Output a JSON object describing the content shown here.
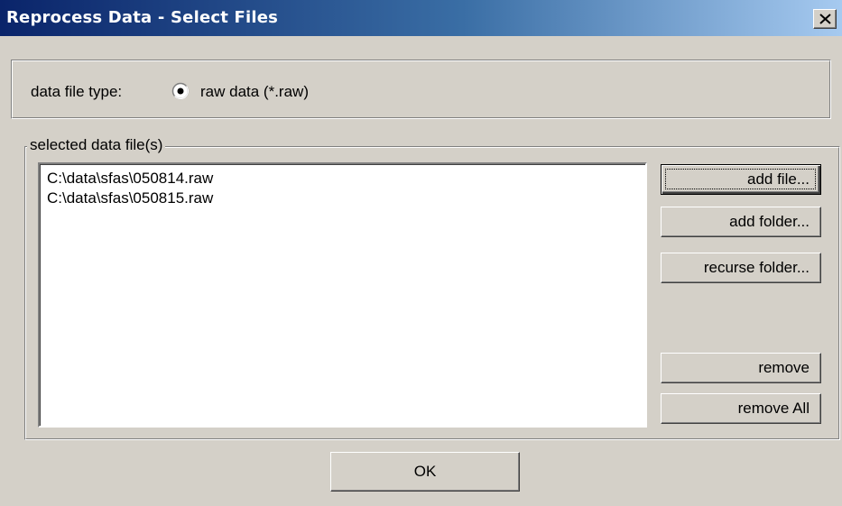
{
  "window": {
    "title": "Reprocess Data - Select Files"
  },
  "file_type": {
    "label": "data file type:",
    "option_label": "raw data (*.raw)",
    "selected": true
  },
  "files": {
    "legend": "selected data file(s)",
    "items": [
      "C:\\data\\sfas\\050814.raw",
      "C:\\data\\sfas\\050815.raw"
    ]
  },
  "buttons": {
    "add_file": "add file...",
    "add_folder": "add folder...",
    "recurse_folder": "recurse folder...",
    "remove": "remove",
    "remove_all": "remove All",
    "ok": "OK"
  },
  "icons": {
    "close": "close-icon",
    "radio": "radio-selected-icon"
  },
  "colors": {
    "title_bar_start": "#0a246a",
    "title_bar_end": "#a6caf0",
    "dialog_background": "#d4d0c8"
  }
}
